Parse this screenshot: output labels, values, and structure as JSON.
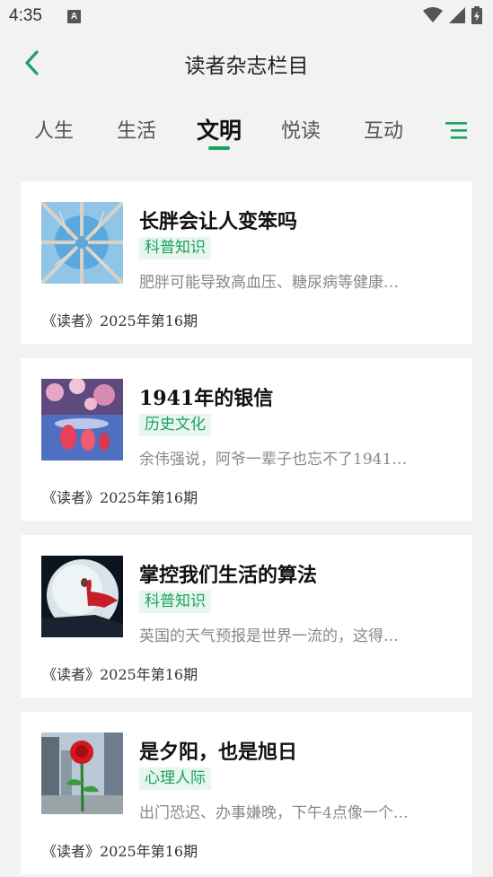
{
  "status": {
    "time": "4:35",
    "badge": "A"
  },
  "header": {
    "title": "读者杂志栏目"
  },
  "tabs": [
    {
      "label": "人生"
    },
    {
      "label": "生活"
    },
    {
      "label": "文明"
    },
    {
      "label": "悦读"
    },
    {
      "label": "互动"
    }
  ],
  "active_tab": "文明",
  "colors": {
    "accent": "#1aa260",
    "tag_bg": "#e8f6ee"
  },
  "articles": [
    {
      "title": "长胖会让人变笨吗",
      "tag": "科普知识",
      "summary": "肥胖可能导致高血压、糖尿病等健康…",
      "source": "《读者》2025年第16期",
      "image": "tree-canopy-image"
    },
    {
      "title": "1941年的银信",
      "tag": "历史文化",
      "summary": "余伟强说，阿爷一辈子也忘不了1941…",
      "source": "《读者》2025年第16期",
      "image": "blossom-reflection-image"
    },
    {
      "title": "掌控我们生活的算法",
      "tag": "科普知识",
      "summary": "英国的天气预报是世界一流的，这得…",
      "source": "《读者》2025年第16期",
      "image": "moon-figure-image"
    },
    {
      "title": "是夕阳，也是旭日",
      "tag": "心理人际",
      "summary": "出门恐迟、办事嫌晚，下午4点像一个…",
      "source": "《读者》2025年第16期",
      "image": "rose-city-image"
    }
  ]
}
